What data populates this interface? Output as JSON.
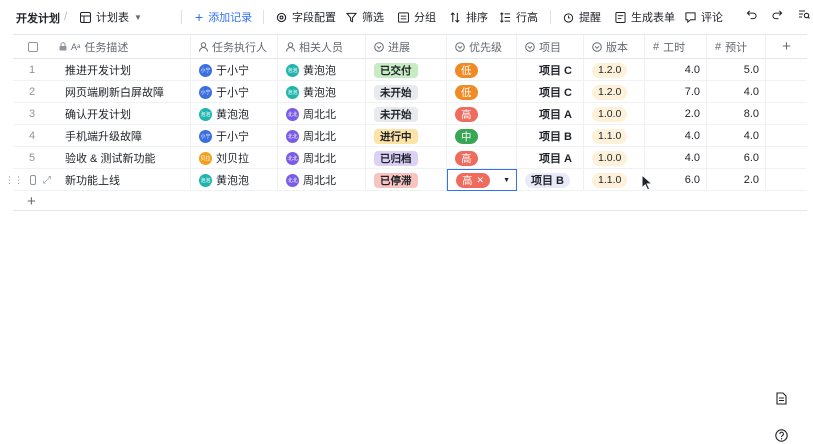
{
  "toolbar": {
    "doc_title": "开发计划",
    "view_name": "计划表",
    "add_record": "添加记录",
    "field_config": "字段配置",
    "filter": "筛选",
    "group": "分组",
    "sort": "排序",
    "row_height": "行高",
    "reminder": "提醒",
    "generate_form": "生成表单",
    "comment": "评论"
  },
  "columns": [
    {
      "key": "task",
      "label": "任务描述"
    },
    {
      "key": "owner",
      "label": "任务执行人"
    },
    {
      "key": "related",
      "label": "相关人员"
    },
    {
      "key": "progress",
      "label": "进展"
    },
    {
      "key": "priority",
      "label": "优先级"
    },
    {
      "key": "project",
      "label": "项目"
    },
    {
      "key": "version",
      "label": "版本"
    },
    {
      "key": "hours",
      "label": "工时"
    },
    {
      "key": "estimate",
      "label": "预计"
    }
  ],
  "rows": [
    {
      "num": "1",
      "task": "推进开发计划",
      "owner": {
        "name": "于小宁",
        "badge": "小宁",
        "color": "#3b6fe0"
      },
      "related": {
        "name": "黄泡泡",
        "badge": "泡泡",
        "color": "#1fb5ad"
      },
      "progress": {
        "text": "已交付",
        "bg": "#c7ebc2",
        "fg": "#1f2329"
      },
      "priority": {
        "text": "低",
        "bg": "#f08a24"
      },
      "project": "项目 C",
      "version": "1.2.0",
      "hours": "4.0",
      "estimate": "5.0"
    },
    {
      "num": "2",
      "task": "网页端刷新白屏故障",
      "owner": {
        "name": "于小宁",
        "badge": "小宁",
        "color": "#3b6fe0"
      },
      "related": {
        "name": "黄泡泡",
        "badge": "泡泡",
        "color": "#1fb5ad"
      },
      "progress": {
        "text": "未开始",
        "bg": "#e8eaed",
        "fg": "#1f2329"
      },
      "priority": {
        "text": "低",
        "bg": "#f08a24"
      },
      "project": "项目 C",
      "version": "1.2.0",
      "hours": "7.0",
      "estimate": "4.0"
    },
    {
      "num": "3",
      "task": "确认开发计划",
      "owner": {
        "name": "黄泡泡",
        "badge": "泡泡",
        "color": "#1fb5ad"
      },
      "related": {
        "name": "周北北",
        "badge": "北北",
        "color": "#7b5ce6"
      },
      "progress": {
        "text": "未开始",
        "bg": "#e8eaed",
        "fg": "#1f2329"
      },
      "priority": {
        "text": "高",
        "bg": "#ef6b5d"
      },
      "project": "项目 A",
      "version": "1.0.0",
      "hours": "2.0",
      "estimate": "8.0"
    },
    {
      "num": "4",
      "task": "手机端升级故障",
      "owner": {
        "name": "于小宁",
        "badge": "小宁",
        "color": "#3b6fe0"
      },
      "related": {
        "name": "周北北",
        "badge": "北北",
        "color": "#7b5ce6"
      },
      "progress": {
        "text": "进行中",
        "bg": "#fde3a5",
        "fg": "#1f2329"
      },
      "priority": {
        "text": "中",
        "bg": "#3aa655"
      },
      "project": "项目 B",
      "version": "1.1.0",
      "hours": "4.0",
      "estimate": "4.0"
    },
    {
      "num": "5",
      "task": "验收 & 测试新功能",
      "owner": {
        "name": "刘贝拉",
        "badge": "贝拉",
        "color": "#f0a020"
      },
      "related": {
        "name": "周北北",
        "badge": "北北",
        "color": "#7b5ce6"
      },
      "progress": {
        "text": "已归档",
        "bg": "#ddd0f5",
        "fg": "#1f2329"
      },
      "priority": {
        "text": "高",
        "bg": "#ef6b5d"
      },
      "project": "项目 A",
      "version": "1.0.0",
      "hours": "4.0",
      "estimate": "6.0"
    },
    {
      "num": "",
      "task": "新功能上线",
      "owner": {
        "name": "黄泡泡",
        "badge": "泡泡",
        "color": "#1fb5ad"
      },
      "related": {
        "name": "周北北",
        "badge": "北北",
        "color": "#7b5ce6"
      },
      "progress": {
        "text": "已停滞",
        "bg": "#f7c4c0",
        "fg": "#1f2329"
      },
      "priority": {
        "text": "高",
        "bg": "#ef6b5d"
      },
      "project": "项目 B",
      "version": "1.1.0",
      "hours": "6.0",
      "estimate": "2.0"
    }
  ],
  "add_row_symbol": "+"
}
